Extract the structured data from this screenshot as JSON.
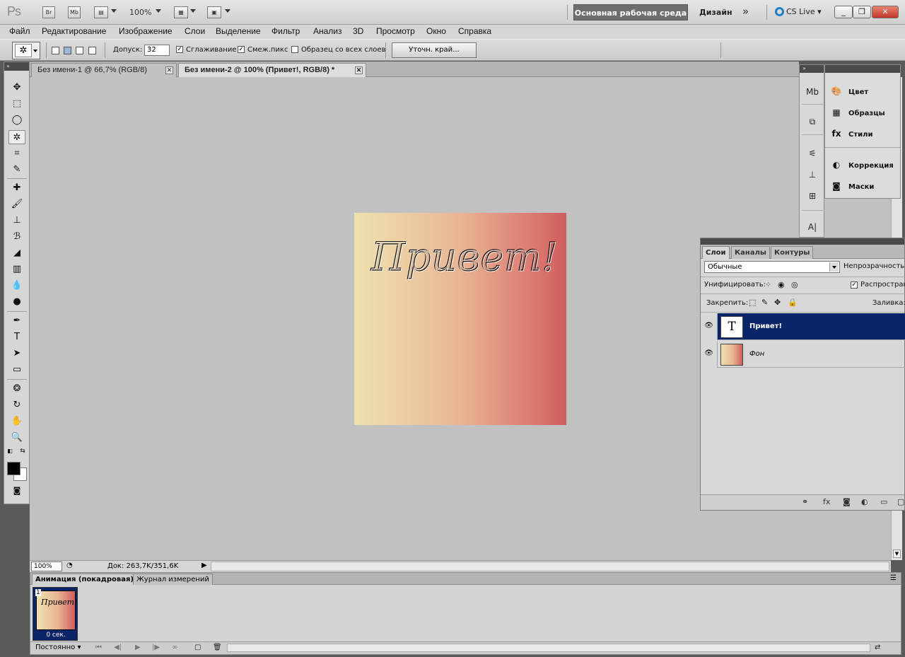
{
  "app": {
    "logo": "Ps",
    "bridge": "Br",
    "minibridge": "Mb",
    "zoom": "100%",
    "workspace_active": "Основная рабочая среда",
    "workspace_other": "Дизайн",
    "more": "»",
    "cslive": "CS Live"
  },
  "menu": [
    "Файл",
    "Редактирование",
    "Изображение",
    "Слои",
    "Выделение",
    "Фильтр",
    "Анализ",
    "3D",
    "Просмотр",
    "Окно",
    "Справка"
  ],
  "options": {
    "tolerance_label": "Допуск:",
    "tolerance_value": "32",
    "antialias_label": "Сглаживание",
    "contiguous_label": "Смеж.пикс",
    "sample_all_label": "Образец со всех слоев",
    "refine_edge": "Уточн. край..."
  },
  "tabs": [
    {
      "label": "Без имени-1 @ 66,7% (RGB/8)"
    },
    {
      "label": "Без имени-2 @ 100% (Привет!, RGB/8) *"
    }
  ],
  "canvas": {
    "text": "Привет!"
  },
  "status": {
    "zoom": "100%",
    "doc": "Док: 263,7K/351,6K"
  },
  "animation": {
    "tab_active": "Анимация (покадровая)",
    "tab_other": "Журнал измерений",
    "frame_number": "1",
    "frame_delay": "0 сек.",
    "frame_text": "Привет!",
    "loop": "Постоянно"
  },
  "dock": {
    "items": [
      "Цвет",
      "Образцы",
      "Стили",
      "Коррекция",
      "Маски"
    ]
  },
  "layers_panel": {
    "tabs": [
      "Слои",
      "Каналы",
      "Контуры"
    ],
    "blend_mode": "Обычные",
    "opacity_label": "Непрозрачность:",
    "unify_label": "Унифицировать:",
    "propagate_label": "Распростран",
    "lock_label": "Закрепить:",
    "fill_label": "Заливка:",
    "layers": [
      {
        "name": "Привет!",
        "thumb": "T"
      },
      {
        "name": "Фон"
      }
    ]
  }
}
